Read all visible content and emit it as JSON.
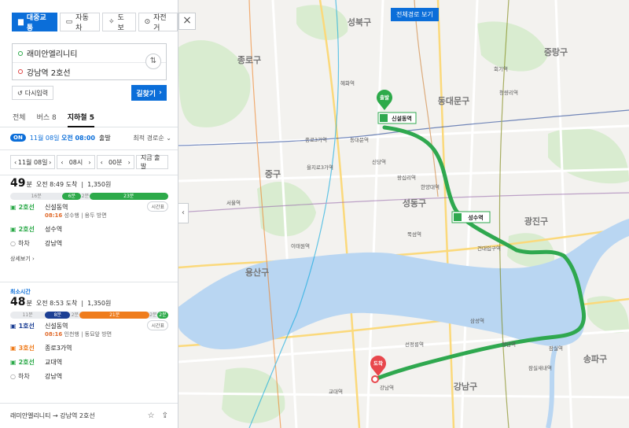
{
  "modes": [
    {
      "icon": "bus-icon",
      "label": "대중교통",
      "active": true
    },
    {
      "icon": "car-icon",
      "label": "자동차",
      "active": false
    },
    {
      "icon": "walk-icon",
      "label": "도보",
      "active": false
    },
    {
      "icon": "bicycle-icon",
      "label": "자전거",
      "active": false
    }
  ],
  "route": {
    "origin": "래미안엘리니티",
    "destination": "강남역 2호선"
  },
  "buttons": {
    "reinput": "다시입력",
    "search": "길찾기",
    "close": "×",
    "full_route": "전체경로 보기"
  },
  "tabs": [
    {
      "label": "전체",
      "active": false
    },
    {
      "label": "버스 8",
      "active": false
    },
    {
      "label": "지하철 5",
      "active": true
    }
  ],
  "filter": {
    "on": "ON",
    "date_prefix": "11월 08일",
    "date_time": "오전 08:00",
    "date_suffix": "출발",
    "sort": "최적 경로순"
  },
  "time_selects": {
    "date": "11월 08일",
    "hour": "08시",
    "minute": "00분",
    "depart_now": "지금 출발"
  },
  "results": [
    {
      "label": "",
      "minutes": "49",
      "unit": "분",
      "arrive": "오전 8:49 도착",
      "fare": "1,350원",
      "segments": [
        {
          "label": "16분",
          "color": "#e9ebee",
          "walk": true,
          "start": 0,
          "end": 0.33
        },
        {
          "label": "6분",
          "color": "#2daa4a",
          "start": 0.33,
          "end": 0.45
        },
        {
          "label": "2분",
          "color": "#e9ebee",
          "walk": true,
          "start": 0.45,
          "end": 0.5
        },
        {
          "label": "23분",
          "color": "#2daa4a",
          "start": 0.5,
          "end": 1.0
        }
      ],
      "steps": [
        {
          "line": "2호선",
          "color": "#2daa4a",
          "station": "신설동역",
          "sub_time": "08:16",
          "sub_dir": "성수행",
          "sub_note": "| 용두 방면",
          "has_timetable": true
        },
        {
          "line": "2호선",
          "color": "#2daa4a",
          "station": "성수역"
        },
        {
          "line": "하차",
          "color": "#888888",
          "station": "강남역"
        }
      ],
      "detail": "상세보기"
    },
    {
      "label": "최소시간",
      "minutes": "48",
      "unit": "분",
      "arrive": "오전 8:53 도착",
      "fare": "1,350원",
      "segments": [
        {
          "label": "11분",
          "color": "#e9ebee",
          "walk": true,
          "start": 0,
          "end": 0.22
        },
        {
          "label": "8분",
          "color": "#1c3f94",
          "start": 0.22,
          "end": 0.38
        },
        {
          "label": "2분",
          "color": "#e9ebee",
          "walk": true,
          "start": 0.38,
          "end": 0.44
        },
        {
          "label": "21분",
          "color": "#ef7c1c",
          "start": 0.44,
          "end": 0.88
        },
        {
          "label": "2분",
          "color": "#e9ebee",
          "walk": true,
          "start": 0.88,
          "end": 0.93
        },
        {
          "label": "2분",
          "color": "#2daa4a",
          "start": 0.93,
          "end": 1.0
        }
      ],
      "steps": [
        {
          "line": "1호선",
          "color": "#1c3f94",
          "station": "신설동역",
          "sub_time": "08:16",
          "sub_dir": "인천행",
          "sub_note": "| 동묘앞 방면",
          "has_timetable": true
        },
        {
          "line": "3호선",
          "color": "#ef7c1c",
          "station": "종로3가역"
        },
        {
          "line": "2호선",
          "color": "#2daa4a",
          "station": "교대역"
        },
        {
          "line": "하차",
          "color": "#888888",
          "station": "강남역"
        }
      ]
    }
  ],
  "timetable_label": "시간표",
  "bottom": {
    "summary": "래미안엘리니티 → 강남역 2호선"
  },
  "map": {
    "start_label": "출발",
    "end_label": "도착",
    "start_station": "신설동역",
    "transfer_station": "성수역",
    "district_labels": [
      "성북구",
      "종로구",
      "동대문구",
      "중랑구",
      "중구",
      "성동구",
      "광진구",
      "용산구",
      "강남구",
      "송파구"
    ],
    "station_labels": [
      "혜화역",
      "동대문역",
      "신당역",
      "왕십리역",
      "건대입구역",
      "한양대역",
      "뚝섬역",
      "청담역",
      "선정릉역",
      "잠실역",
      "교대역",
      "강남역",
      "종로3가역",
      "을지로3가역",
      "서울역",
      "이태원역",
      "청량리역",
      "회기역",
      "잠실새내역",
      "삼성역"
    ],
    "colors": {
      "river": "#b9d6f2",
      "route": "#2fa84f",
      "park": "#d9ecd0",
      "land": "#f3f2ef",
      "start_pin": "#2daa4a",
      "end_pin": "#e8474c"
    }
  }
}
